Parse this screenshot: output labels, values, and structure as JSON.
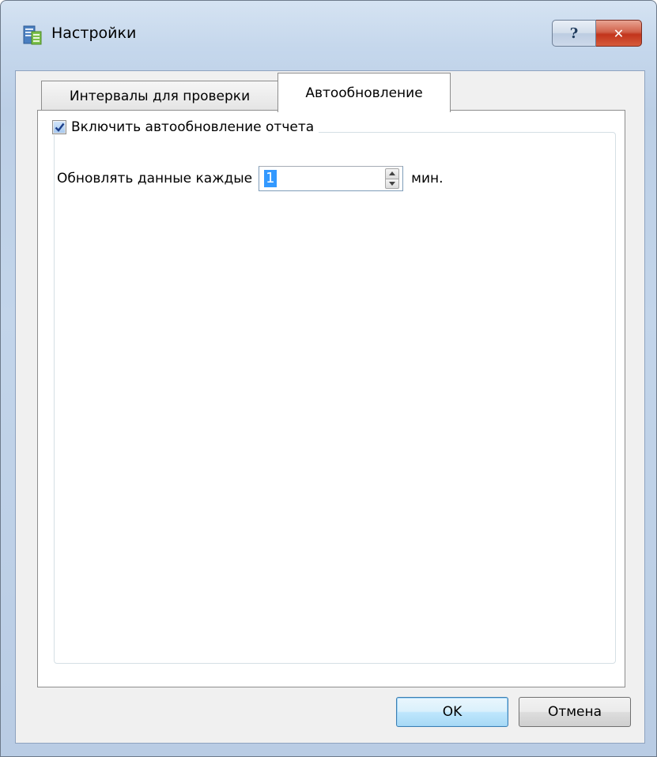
{
  "window": {
    "title": "Настройки",
    "help_glyph": "?",
    "close_glyph": "✕"
  },
  "tabs": [
    {
      "label": "Интервалы для проверки",
      "active": false
    },
    {
      "label": "Автообновление",
      "active": true
    }
  ],
  "autoupdate": {
    "enable_label": "Включить автообновление отчета",
    "enabled": true,
    "interval_label": "Обновлять данные каждые",
    "interval_value": "1",
    "unit_label": "мин."
  },
  "buttons": {
    "ok_label": "OK",
    "cancel_label": "Отмена"
  },
  "colors": {
    "accent_selection": "#3399ff",
    "close_red": "#c2341b",
    "ok_focus": "#3c7fb1"
  }
}
